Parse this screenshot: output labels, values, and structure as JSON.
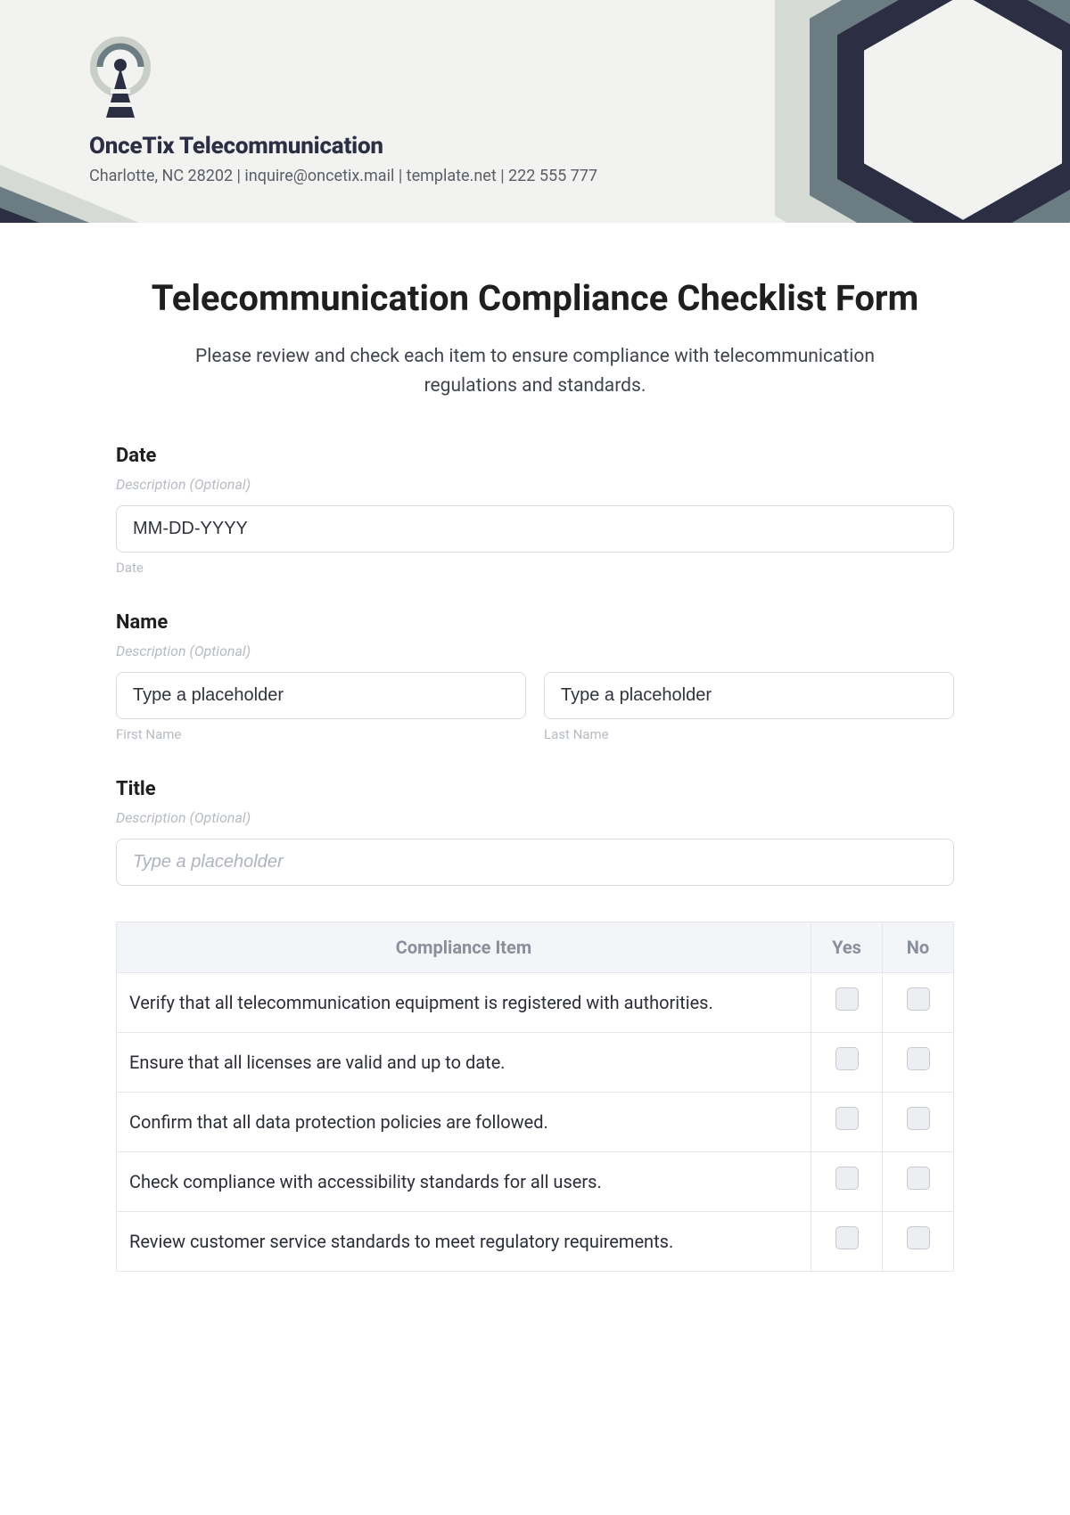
{
  "header": {
    "company": "OnceTix Telecommunication",
    "meta": "Charlotte, NC 28202 | inquire@oncetix.mail | template.net | 222 555 777"
  },
  "form": {
    "title": "Telecommunication Compliance Checklist Form",
    "intro": "Please review and check each item to ensure compliance with telecommunication regulations and standards."
  },
  "fields": {
    "date": {
      "label": "Date",
      "desc": "Description (Optional)",
      "placeholder": "MM-DD-YYYY",
      "sub": "Date"
    },
    "name": {
      "label": "Name",
      "desc": "Description (Optional)",
      "first_placeholder": "Type a placeholder",
      "first_sub": "First Name",
      "last_placeholder": "Type a placeholder",
      "last_sub": "Last Name"
    },
    "title_field": {
      "label": "Title",
      "desc": "Description (Optional)",
      "placeholder": "Type a placeholder"
    }
  },
  "table": {
    "headers": {
      "item": "Compliance Item",
      "yes": "Yes",
      "no": "No"
    },
    "rows": [
      "Verify that all telecommunication equipment is registered with authorities.",
      "Ensure that all licenses are valid and up to date.",
      "Confirm that all data protection policies are followed.",
      "Check compliance with accessibility standards for all users.",
      "Review customer service standards to meet regulatory requirements."
    ]
  }
}
